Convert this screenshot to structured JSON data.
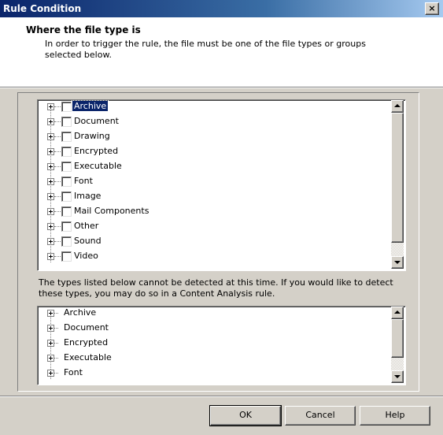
{
  "window": {
    "title": "Rule Condition",
    "close_label": "×"
  },
  "header": {
    "title": "Where the file type is",
    "description_line1": "In order to trigger the rule, the file must be one of the file types or groups",
    "description_line2": "selected below."
  },
  "file_types": {
    "selected": "Archive",
    "items": [
      {
        "label": "Archive",
        "checked": false,
        "selected": true
      },
      {
        "label": "Document",
        "checked": false
      },
      {
        "label": "Drawing",
        "checked": false
      },
      {
        "label": "Encrypted",
        "checked": false
      },
      {
        "label": "Executable",
        "checked": false
      },
      {
        "label": "Font",
        "checked": false
      },
      {
        "label": "Image",
        "checked": false
      },
      {
        "label": "Mail Components",
        "checked": false
      },
      {
        "label": "Other",
        "checked": false
      },
      {
        "label": "Sound",
        "checked": false
      },
      {
        "label": "Video",
        "checked": false
      }
    ]
  },
  "undetectable": {
    "info_text": "The types listed below cannot be detected at this time. If you would like to detect these types, you may do so in a Content Analysis rule.",
    "items": [
      {
        "label": "Archive"
      },
      {
        "label": "Document"
      },
      {
        "label": "Encrypted"
      },
      {
        "label": "Executable"
      },
      {
        "label": "Font"
      }
    ]
  },
  "buttons": {
    "ok": "OK",
    "cancel": "Cancel",
    "help": "Help"
  },
  "colors": {
    "titlebar": "#0a246a",
    "face": "#d4d0c8",
    "selection": "#0a246a"
  }
}
